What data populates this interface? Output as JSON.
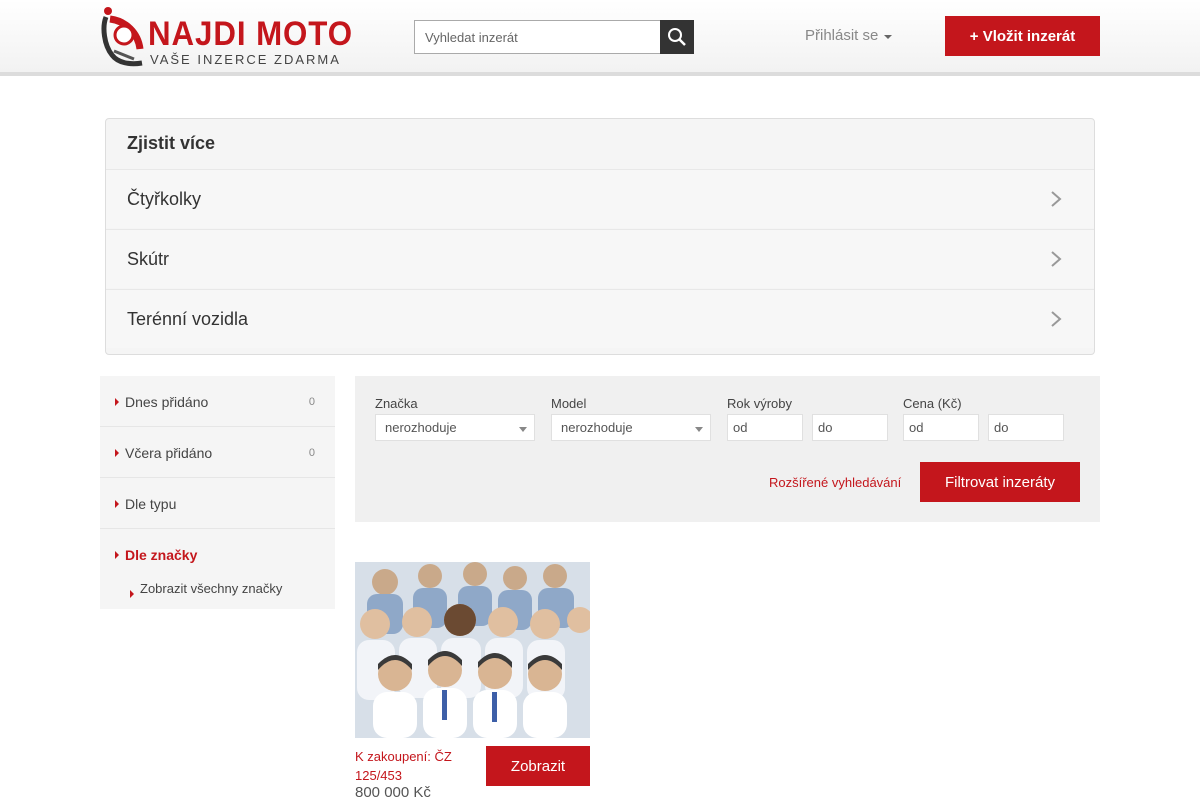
{
  "header": {
    "logo_title": "NAJDI MOTO",
    "logo_subtitle": "VAŠE INZERCE ZDARMA",
    "search_placeholder": "Vyhledat inzerát",
    "login_label": "Přihlásit se",
    "add_button_label": "+ Vložit inzerát"
  },
  "more": {
    "title": "Zjistit více",
    "items": [
      {
        "label": "Čtyřkolky"
      },
      {
        "label": "Skútr"
      },
      {
        "label": "Terénní vozidla"
      }
    ]
  },
  "sidebar": {
    "items": [
      {
        "label": "Dnes přidáno",
        "count": "0"
      },
      {
        "label": "Včera přidáno",
        "count": "0"
      },
      {
        "label": "Dle typu"
      },
      {
        "label": "Dle značky",
        "sub": "Zobrazit všechny značky"
      }
    ]
  },
  "filter": {
    "brand_label": "Značka",
    "brand_value": "nerozhoduje",
    "model_label": "Model",
    "model_value": "nerozhoduje",
    "year_label": "Rok výroby",
    "year_from_placeholder": "od",
    "year_to_placeholder": "do",
    "price_label": "Cena (Kč)",
    "price_from_placeholder": "od",
    "price_to_placeholder": "do",
    "advanced_link": "Rozšířené vyhledávání",
    "submit_label": "Filtrovat inzeráty"
  },
  "listing": {
    "title": "K zakoupení: ČZ 125/453",
    "price": "800 000 Kč",
    "button_label": "Zobrazit"
  },
  "colors": {
    "accent": "#c4161c",
    "dark": "#333333",
    "panel": "#f5f5f5"
  }
}
